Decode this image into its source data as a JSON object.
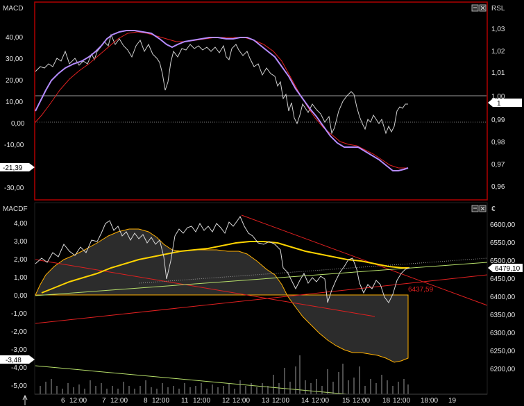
{
  "upper_panel": {
    "left_title": "MACD",
    "right_title": "RSL",
    "left_ticks": [
      "40,00",
      "30,00",
      "20,00",
      "10,00",
      "0,00",
      "-10,00",
      "-20,00",
      "-30,00"
    ],
    "right_ticks": [
      "1,03",
      "1,02",
      "1,01",
      "1,00",
      "0,99",
      "0,98",
      "0,97",
      "0,96"
    ],
    "left_marker": "-21,39",
    "right_marker": "1"
  },
  "lower_panel": {
    "left_title": "MACDF",
    "right_title": "€",
    "left_ticks": [
      "4,00",
      "3,00",
      "2,00",
      "1,00",
      "0,00",
      "-1,00",
      "-2,00",
      "-3,00",
      "-4,00",
      "-5,00"
    ],
    "right_ticks": [
      "6600,00",
      "6550,00",
      "6500,00",
      "6450,00",
      "6400,00",
      "6350,00",
      "6300,00",
      "6250,00",
      "6200,00"
    ],
    "left_marker": "-3,48",
    "right_marker": "6479,10",
    "annotation": "6437,59"
  },
  "time_axis": {
    "labels": [
      "6",
      "12:00",
      "7",
      "12:00",
      "8",
      "12:00",
      "11",
      "12:00",
      "12",
      "12:00",
      "13",
      "12:00",
      "14",
      "12:00",
      "15",
      "12:00",
      "18",
      "12:00",
      "18:00",
      "19"
    ]
  },
  "colors": {
    "frame": "#b00000",
    "purple": "#b58cff",
    "red": "#e02020",
    "orange": "#ffb000",
    "yellow_green": "#b7e06a",
    "gray_fill": "#2c2c2c"
  },
  "window_controls": {
    "upper_icons": [
      "restore-icon",
      "close-icon"
    ],
    "lower_icons": [
      "restore-icon",
      "close-icon"
    ]
  }
}
